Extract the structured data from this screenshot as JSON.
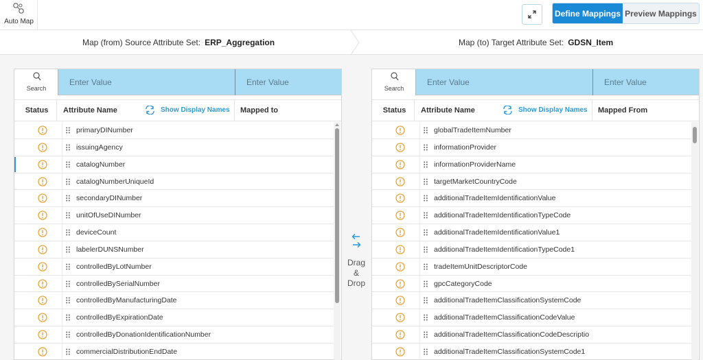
{
  "toolbar": {
    "auto_map_label": "Auto Map",
    "tabs": {
      "define": "Define Mappings",
      "preview": "Preview Mappings"
    }
  },
  "mapbar": {
    "source_label": "Map (from) Source Attribute Set:",
    "source_value": "ERP_Aggregation",
    "target_label": "Map (to) Target Attribute Set:",
    "target_value": "GDSN_Item"
  },
  "source_panel": {
    "search_label": "Search",
    "input1_placeholder": "Enter Value",
    "input2_placeholder": "Enter Value",
    "headers": {
      "status": "Status",
      "name": "Attribute Name",
      "show": "Show Display Names",
      "mapped": "Mapped to"
    },
    "rows": [
      "primaryDINumber",
      "issuingAgency",
      "catalogNumber",
      "catalogNumberUniqueId",
      "secondaryDINumber",
      "unitOfUseDINumber",
      "deviceCount",
      "labelerDUNSNumber",
      "controlledByLotNumber",
      "controlledBySerialNumber",
      "controlledByManufacturingDate",
      "controlledByExpirationDate",
      "controlledByDonationIdentificationNumber",
      "commercialDistributionEndDate"
    ]
  },
  "target_panel": {
    "search_label": "Search",
    "input1_placeholder": "Enter Value",
    "input2_placeholder": "Enter Value",
    "headers": {
      "status": "Status",
      "name": "Attribute Name",
      "show": "Show Display Names",
      "mapped": "Mapped From"
    },
    "rows": [
      "globalTradeItemNumber",
      "informationProvider",
      "informationProviderName",
      "targetMarketCountryCode",
      "additionalTradeItemIdentificationValue",
      "additionalTradeItemIdentificationTypeCode",
      "additionalTradeItemIdentificationValue1",
      "additionalTradeItemIdentificationTypeCode1",
      "tradeItemUnitDescriptorCode",
      "gpcCategoryCode",
      "additionalTradeItemClassificationSystemCode",
      "additionalTradeItemClassificationCodeValue",
      "additionalTradeItemClassificationCodeDescriptio",
      "additionalTradeItemClassificationSystemCode1"
    ]
  },
  "drag_drop": {
    "line1": "Drag",
    "line2": "&",
    "line3": "Drop"
  },
  "colors": {
    "accent": "#1b8ad6",
    "search_bar": "#a8dcf5",
    "warning": "#e8a33a"
  },
  "icons": {
    "auto_map": "auto-map-icon",
    "expand": "expand-icon",
    "search": "search-icon",
    "refresh": "refresh-icon",
    "status": "warning-circle-icon",
    "grip": "drag-handle-icon",
    "swap": "swap-arrows-icon"
  }
}
